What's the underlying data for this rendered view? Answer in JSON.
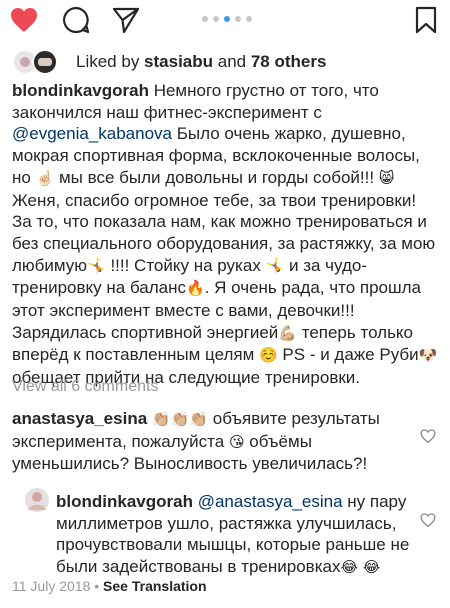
{
  "actions": {
    "like_icon": "heart-filled-icon",
    "comment_icon": "comment-bubble-icon",
    "share_icon": "paper-plane-icon",
    "like_color": "#ed4956",
    "carousel_dots": 5,
    "carousel_active_index": 2
  },
  "likes": {
    "prefix": "Liked by ",
    "user": "stasiabu",
    "middle": " and ",
    "others": "78 others"
  },
  "caption": {
    "username": "blondinkavgorah",
    "text_1": " Немного грустно от того, что закончился наш фитнес-эксперимент с ",
    "mention": "@evgenia_kabanova",
    "text_2": " Было очень жарко, душевно, мокрая спортивная форма, всклокоченные волосы, но ",
    "emoji_1": "☝🏻",
    "text_3": " мы все были довольны и горды собой!!! ",
    "emoji_2": "😸",
    "text_4": " Женя, спасибо огромное тебе, за твои тренировки! За то, что показала нам, как можно тренироваться и без специального оборудования, за растяжку, за мою любимую",
    "emoji_3": "🤸",
    "text_5": " !!!! Стойку на руках ",
    "emoji_4": "🤸",
    "text_6": "  и за чудо-тренировку на баланс",
    "emoji_5": "🔥",
    "text_7": ". Я очень рада, что прошла этот эксперимент вместе с вами, девочки!!! Зарядилась спортивной энергией",
    "emoji_6": "💪🏼",
    "text_8": " теперь только вперёд к поставленным целям ",
    "emoji_7": "☺️",
    "text_9": " PS - и даже Руби",
    "emoji_8": "🐶",
    "text_10": " обещает прийти на следующие тренировки."
  },
  "view_all": "View all 6 comments",
  "comment": {
    "username": "anastasya_esina",
    "emojis": " 👏🏼👏🏼👏🏼 ",
    "text_1": "объявите результаты эксперимента, пожалуйста ",
    "emoji": "😘",
    "text_2": " объёмы уменьшились? Выносливость увеличилась?!"
  },
  "reply": {
    "username": "blondinkavgorah",
    "mention": "@anastasya_esina",
    "text_1": " ну пару миллиметров ушло, растяжка улучшилась, прочувствовали мышцы, которые раньше не были задействованы в тренировках",
    "emoji_1": "😂",
    "emoji_2": "😂"
  },
  "footer": {
    "date": "11 July 2018",
    "sep": " • ",
    "see_translation": "See Translation"
  }
}
